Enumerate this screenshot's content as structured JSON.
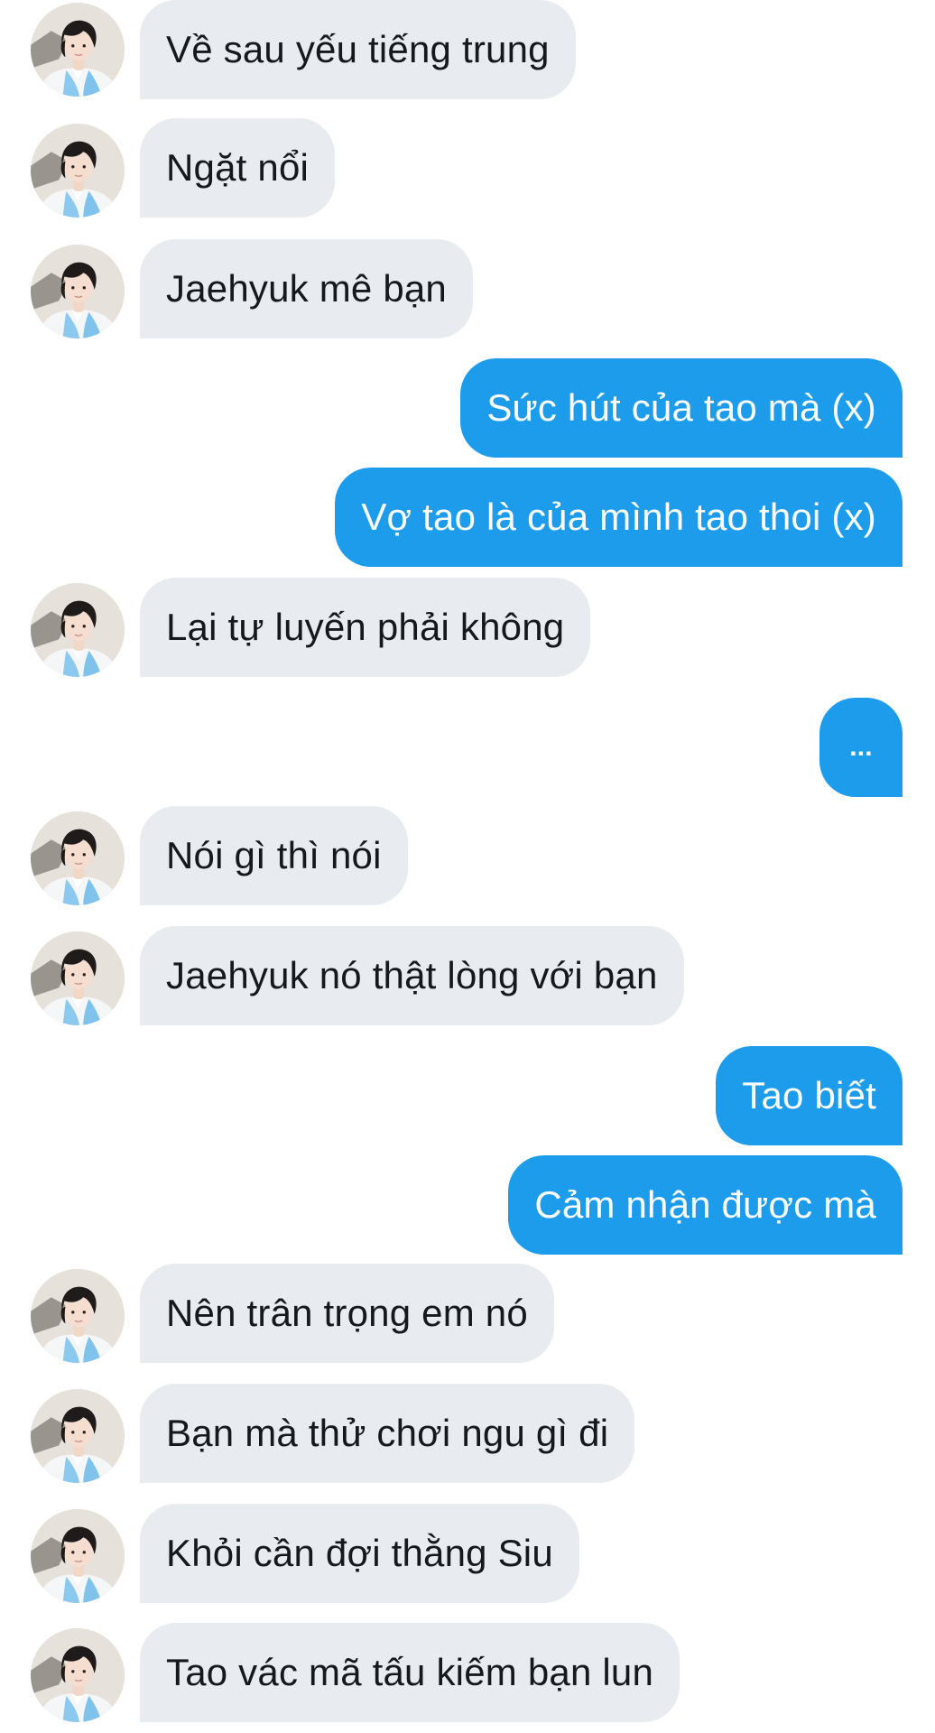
{
  "conversation": {
    "messages": [
      {
        "sender": "other",
        "text": "Về sau yếu tiếng trung",
        "avatar_icon": "contact-avatar"
      },
      {
        "sender": "other",
        "text": "Ngặt nổi",
        "avatar_icon": "contact-avatar"
      },
      {
        "sender": "other",
        "text": "Jaehyuk mê bạn",
        "avatar_icon": "contact-avatar"
      },
      {
        "sender": "me",
        "text": "Sức hút của tao mà (x)"
      },
      {
        "sender": "me",
        "text": "Vợ tao là của mình tao thoi (x)"
      },
      {
        "sender": "other",
        "text": "Lại tự luyến phải không",
        "avatar_icon": "contact-avatar"
      },
      {
        "sender": "me",
        "text": "..."
      },
      {
        "sender": "other",
        "text": "Nói gì thì nói",
        "avatar_icon": "contact-avatar"
      },
      {
        "sender": "other",
        "text": "Jaehyuk nó thật lòng với bạn",
        "avatar_icon": "contact-avatar"
      },
      {
        "sender": "me",
        "text": "Tao biết"
      },
      {
        "sender": "me",
        "text": "Cảm nhận được mà"
      },
      {
        "sender": "other",
        "text": "Nên trân trọng em nó",
        "avatar_icon": "contact-avatar"
      },
      {
        "sender": "other",
        "text": "Bạn mà thử chơi ngu gì đi",
        "avatar_icon": "contact-avatar"
      },
      {
        "sender": "other",
        "text": "Khỏi cần đợi thằng Siu",
        "avatar_icon": "contact-avatar"
      },
      {
        "sender": "other",
        "text": "Tao vác mã tấu kiếm bạn lun",
        "avatar_icon": "contact-avatar"
      }
    ]
  },
  "colors": {
    "incoming_bubble": "#e8ebef",
    "outgoing_bubble": "#1e9cec",
    "incoming_text": "#15181c",
    "outgoing_text": "#ffffff"
  }
}
